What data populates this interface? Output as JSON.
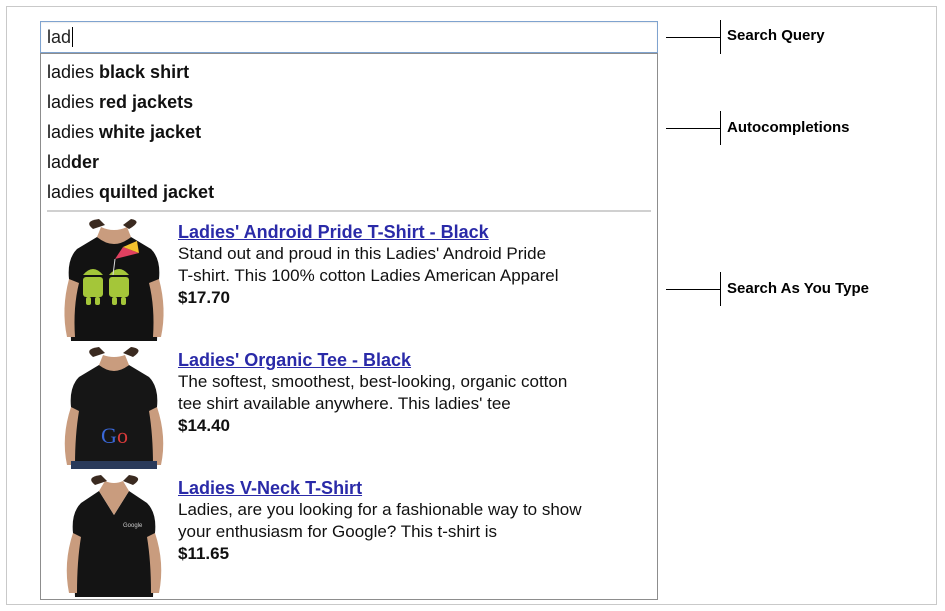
{
  "search": {
    "query": "lad"
  },
  "autocomplete": {
    "items": [
      {
        "prefix": "ladies",
        "rest": " black shirt",
        "prefix_bold": false
      },
      {
        "prefix": "ladies",
        "rest": " red jackets",
        "prefix_bold": false
      },
      {
        "prefix": "ladies",
        "rest": " white jacket",
        "prefix_bold": false
      },
      {
        "prefix": "lad",
        "rest": "der",
        "prefix_bold": false
      },
      {
        "prefix": "ladies",
        "rest": " quilted jacket",
        "prefix_bold": false
      }
    ]
  },
  "products": [
    {
      "title": "Ladies' Android Pride T-Shirt - Black",
      "desc1": "Stand out and proud in this Ladies' Android Pride",
      "desc2": "T-shirt. This 100% cotton Ladies American Apparel",
      "price": "$17.70",
      "image": "android-pride-tshirt-image"
    },
    {
      "title": "Ladies' Organic Tee - Black",
      "desc1": "The softest, smoothest, best-looking, organic cotton",
      "desc2": "tee shirt available anywhere. This ladies' tee",
      "price": "$14.40",
      "image": "organic-tee-image"
    },
    {
      "title": "Ladies V-Neck T-Shirt",
      "desc1": "Ladies, are you looking for a fashionable way to show",
      "desc2": "your enthusiasm for Google? This t-shirt is",
      "price": "$11.65",
      "image": "vneck-tshirt-image"
    }
  ],
  "callouts": {
    "search_query": "Search Query",
    "autocompletions": "Autocompletions",
    "search_as_you_type": "Search As You Type"
  },
  "colors": {
    "link": "#2a2aa8",
    "search_border": "#7fa3cf",
    "divider": "#d0d0d0"
  }
}
